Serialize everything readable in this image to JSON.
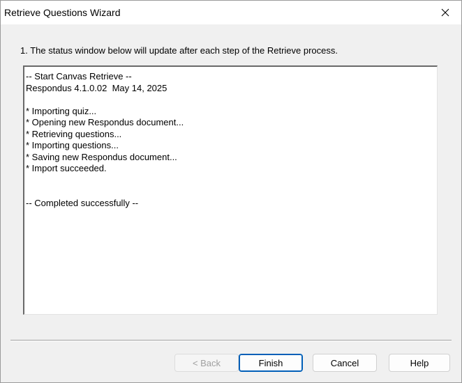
{
  "window": {
    "title": "Retrieve Questions Wizard",
    "close_icon": "close-icon"
  },
  "instruction": "1.  The status window below will update after each step of the Retrieve process.",
  "status_window": {
    "text": "-- Start Canvas Retrieve --\nRespondus 4.1.0.02  May 14, 2025\n\n* Importing quiz...\n* Opening new Respondus document...\n* Retrieving questions...\n* Importing questions...\n* Saving new Respondus document...\n* Import succeeded.\n\n\n-- Completed successfully --"
  },
  "buttons": {
    "back": "< Back",
    "finish": "Finish",
    "cancel": "Cancel",
    "help": "Help"
  },
  "colors": {
    "dialog_background": "#f0f0f0",
    "titlebar_background": "#ffffff",
    "default_button_border": "#005fb8",
    "disabled_text": "#a0a0a0"
  }
}
